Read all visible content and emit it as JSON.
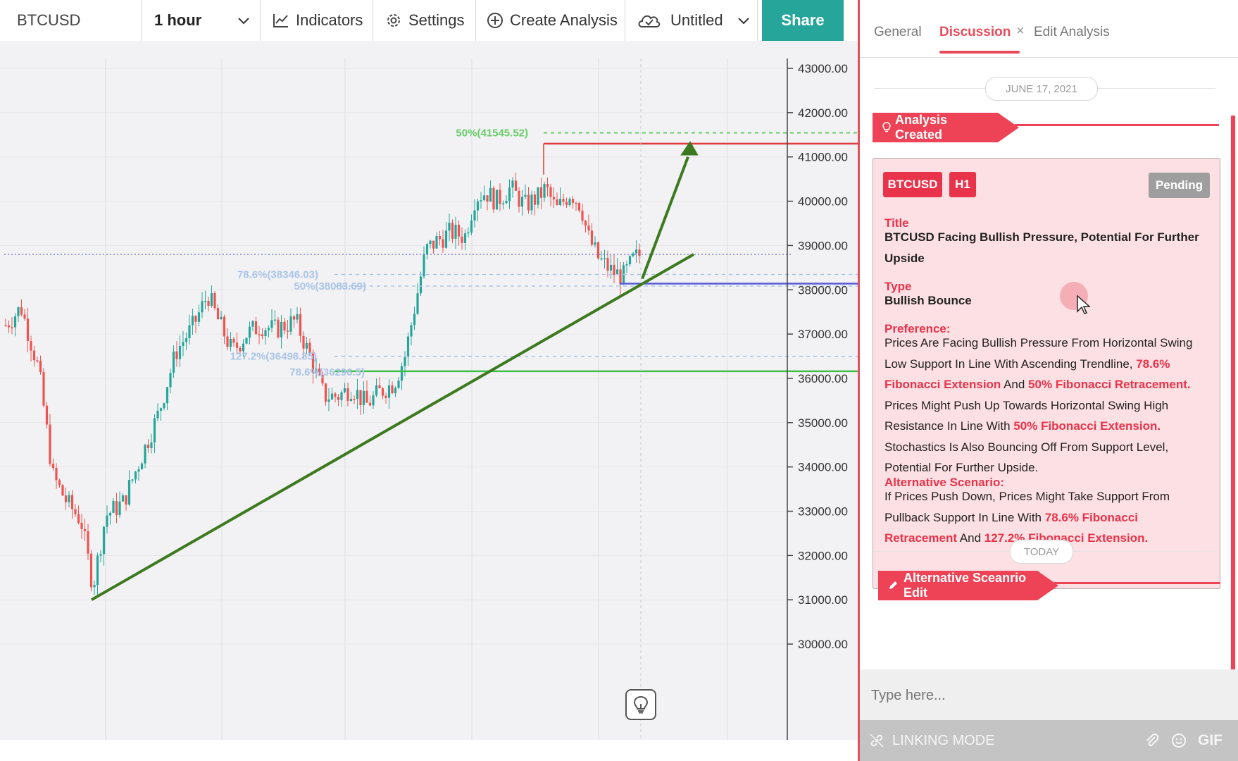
{
  "toolbar": {
    "symbol": "BTCUSD",
    "interval": "1 hour",
    "indicators": "Indicators",
    "settings": "Settings",
    "create_analysis": "Create Analysis",
    "analysis_name": "Untitled",
    "share": "Share"
  },
  "chart": {
    "price_axis": [
      "43000.00",
      "42000.00",
      "41000.00",
      "40000.00",
      "39000.00",
      "38000.00",
      "37000.00",
      "36000.00",
      "35000.00",
      "34000.00",
      "33000.00",
      "32000.00",
      "31000.00",
      "30000.00"
    ],
    "fib_labels": {
      "top": "50%(41545.52)",
      "mid1": "78.6%(38346.03)",
      "mid2": "50%(38083.69)",
      "low1": "127.2%(36498.85)",
      "low2": "78.6%(36296.5)"
    },
    "colors": {
      "up": "#26a69a",
      "down": "#ef5350",
      "trend": "#3d7a1f",
      "fib_green": "#66cc66",
      "fib_blue": "#a9c4e8",
      "resistance": "#e03c3c",
      "support": "#5b5bd6"
    }
  },
  "panel": {
    "tabs": [
      "General",
      "Discussion",
      "Edit Analysis"
    ],
    "active_tab": "Discussion",
    "date1": "JUNE 17, 2021",
    "event1": "Analysis Created",
    "card": {
      "symbol": "BTCUSD",
      "timeframe": "H1",
      "status": "Pending",
      "title_label": "Title",
      "title": "BTCUSD Facing Bullish Pressure, Potential For Further Upside",
      "type_label": "Type",
      "type": "Bullish Bounce",
      "preference_label": "Preference:",
      "preference": [
        {
          "t": "Prices Are Facing Bullish Pressure From Horizontal Swing Low Support In Line With Ascending Trendline, ",
          "h": false
        },
        {
          "t": "78.6% Fibonacci Extension",
          "h": true
        },
        {
          "t": " And ",
          "h": false
        },
        {
          "t": "50% Fibonacci Retracement.",
          "h": true
        },
        {
          "t": " Prices Might Push Up Towards Horizontal Swing High Resistance In Line With ",
          "h": false
        },
        {
          "t": "50% Fibonacci Extension.",
          "h": true
        },
        {
          "t": " Stochastics Is Also Bouncing Off From Support Level, Potential For Further Upside.",
          "h": false
        }
      ],
      "alternative_label": "Alternative Scenario:",
      "alternative": [
        {
          "t": "If Prices Push Down, Prices Might Take Support From Pullback Support In Line With ",
          "h": false
        },
        {
          "t": "78.6% Fibonacci Retracement",
          "h": true
        },
        {
          "t": " And ",
          "h": false
        },
        {
          "t": "127.2% Fibonacci Extension.",
          "h": true
        }
      ]
    },
    "date2": "TODAY",
    "event2": "Alternative Sceanrio Edit",
    "input_placeholder": "Type here...",
    "linking_mode": "LINKING MODE",
    "gif": "GIF",
    "accent": "#ee4356"
  }
}
